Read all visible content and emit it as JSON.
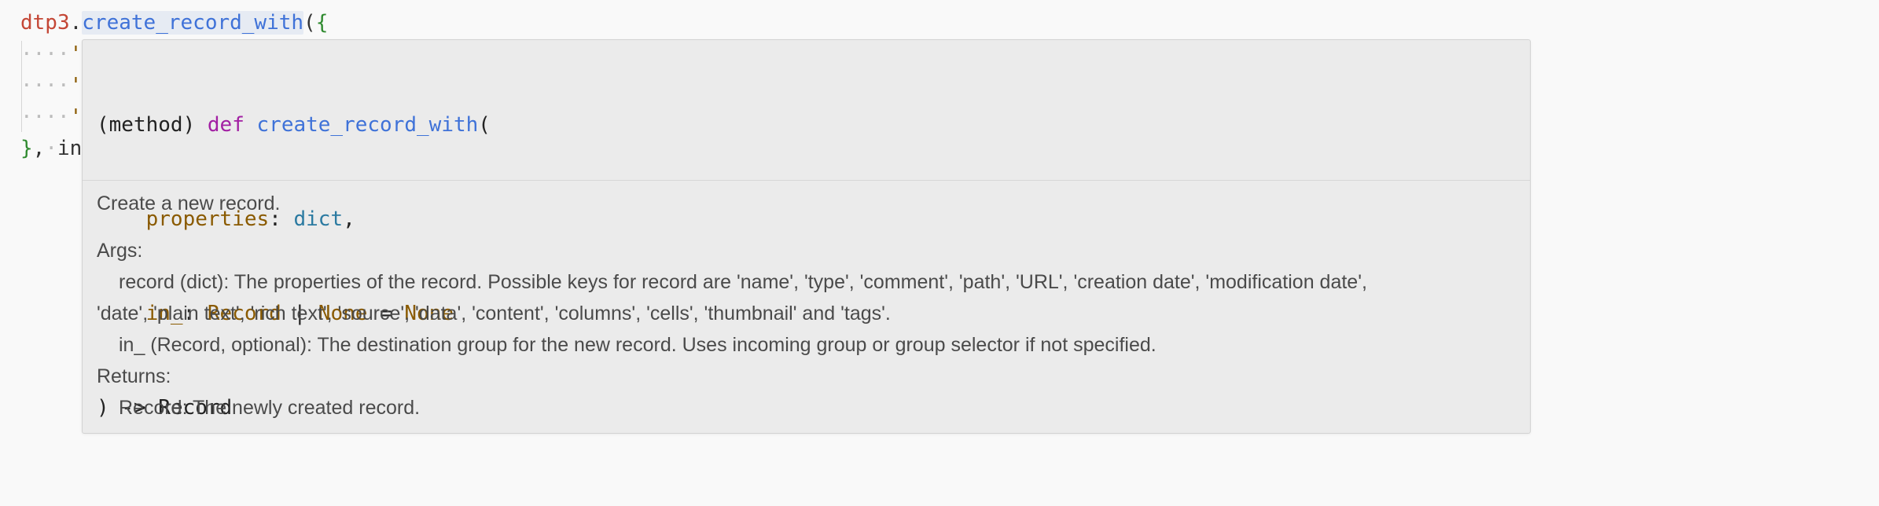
{
  "code": {
    "line1": {
      "obj": "dtp3",
      "dot": ".",
      "func": "create_record_with",
      "open_paren": "(",
      "open_brace": "{"
    },
    "line2": {
      "leading_ws": "····",
      "quote": "'"
    },
    "line3": {
      "leading_ws": "····",
      "quote": "'"
    },
    "line4": {
      "leading_ws": "····",
      "quote": "'"
    },
    "line5": {
      "close_brace": "}",
      "comma": ",",
      "ws": "·",
      "partial": "in"
    }
  },
  "hover": {
    "signature": {
      "line1": {
        "prefix": "(method)",
        "keyword": "def",
        "name": "create_record_with",
        "open": "("
      },
      "line2": {
        "indent": "    ",
        "param": "properties",
        "colon": ": ",
        "type": "dict",
        "comma": ","
      },
      "line3": {
        "indent": "    ",
        "param": "in_",
        "colon": ": ",
        "type": "Record",
        "pipe": " | ",
        "type2": "None",
        "eq": " = ",
        "default": "None"
      },
      "line4": {
        "close": ") -> ",
        "ret": "Record"
      }
    },
    "doc": {
      "summary": "Create a new record.",
      "args_header": "Args:",
      "arg1_line1": "record (dict): The properties of the record. Possible keys for record are 'name', 'type', 'comment', 'path', 'URL', 'creation date', 'modification date',",
      "arg1_line2": "'date', 'plain text', 'rich text', 'source', 'data', 'content', 'columns', 'cells', 'thumbnail' and 'tags'.",
      "arg2": "in_ (Record, optional): The destination group for the new record. Uses incoming group or group selector if not specified.",
      "returns_header": "Returns:",
      "returns": "Record: The newly created record."
    }
  }
}
